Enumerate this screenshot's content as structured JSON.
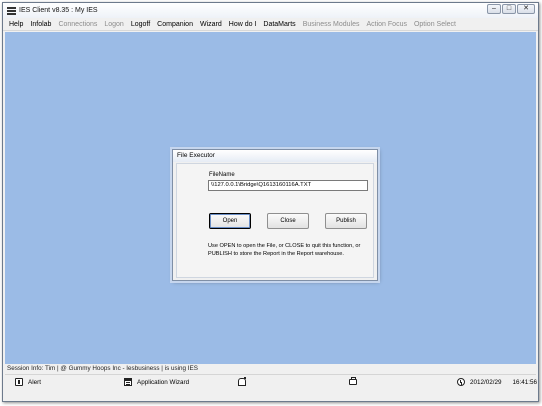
{
  "window": {
    "title": "IES Client v8.35 : My IES",
    "controls": {
      "minimize": "–",
      "maximize": "□",
      "close": "✕"
    }
  },
  "menubar": {
    "items": [
      {
        "label": "Help",
        "enabled": true
      },
      {
        "label": "Infolab",
        "enabled": true
      },
      {
        "label": "Connections",
        "enabled": false
      },
      {
        "label": "Logon",
        "enabled": false
      },
      {
        "label": "Logoff",
        "enabled": true
      },
      {
        "label": "Companion",
        "enabled": true
      },
      {
        "label": "Wizard",
        "enabled": true
      },
      {
        "label": "How do I",
        "enabled": true
      },
      {
        "label": "DataMarts",
        "enabled": true
      },
      {
        "label": "Business Modules",
        "enabled": false
      },
      {
        "label": "Action Focus",
        "enabled": false
      },
      {
        "label": "Option Select",
        "enabled": false
      }
    ]
  },
  "dialog": {
    "title": "File Executor",
    "filename_label": "FileName",
    "filename_value": "\\\\127.0.0.1\\Bridge\\Q1613160116A.TXT",
    "buttons": {
      "open": "Open",
      "close": "Close",
      "publish": "Publish"
    },
    "help_line1": "Use OPEN to open the File, or CLOSE to quit this function, or",
    "help_line2": "PUBLISH to store the Report in the Report warehouse."
  },
  "session_info": "Session Info: Tim | @ Gummy Hoops Inc - Iesbusiness | is using IES",
  "statusbar": {
    "alert": "Alert",
    "application_wizard": "Application Wizard",
    "date": "2012/02/29",
    "time": "16:41:56",
    "icons": {
      "alert": "alert-icon",
      "application_wizard": "application-wizard-icon",
      "notify": "bell-icon",
      "sync": "sync-icon",
      "clock": "clock-icon"
    }
  },
  "colors": {
    "workspace": "#9bbbe6",
    "chrome": "#f0f0f0"
  }
}
